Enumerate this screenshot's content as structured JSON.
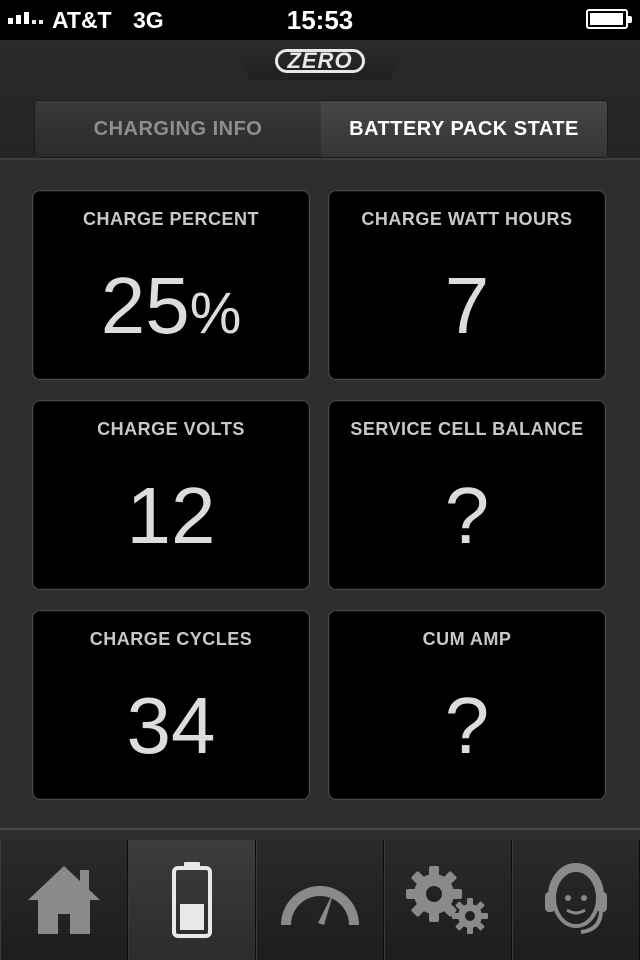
{
  "status_bar": {
    "carrier": "AT&T",
    "network": "3G",
    "time": "15:53"
  },
  "header": {
    "logo_text": "ZERO",
    "tabs": [
      {
        "label": "CHARGING INFO",
        "selected": false
      },
      {
        "label": "BATTERY PACK STATE",
        "selected": true
      }
    ]
  },
  "tiles": [
    {
      "label": "CHARGE PERCENT",
      "value": "25",
      "unit": "%"
    },
    {
      "label": "CHARGE WATT HOURS",
      "value": "7",
      "unit": ""
    },
    {
      "label": "CHARGE VOLTS",
      "value": "12",
      "unit": ""
    },
    {
      "label": "SERVICE CELL BALANCE",
      "value": "?",
      "unit": ""
    },
    {
      "label": "CHARGE CYCLES",
      "value": "34",
      "unit": ""
    },
    {
      "label": "CUM AMP",
      "value": "?",
      "unit": ""
    }
  ],
  "tabbar": {
    "items": [
      {
        "icon": "home-icon",
        "selected": false
      },
      {
        "icon": "battery-icon",
        "selected": true
      },
      {
        "icon": "speedometer-icon",
        "selected": false
      },
      {
        "icon": "gears-icon",
        "selected": false
      },
      {
        "icon": "support-headset-icon",
        "selected": false
      }
    ]
  },
  "colors": {
    "background": "#2e2e2e",
    "tile_background": "#000000",
    "text_primary": "#dcdcdc",
    "text_muted": "#8e8e8e",
    "icon_gray": "#8a8a8a"
  }
}
